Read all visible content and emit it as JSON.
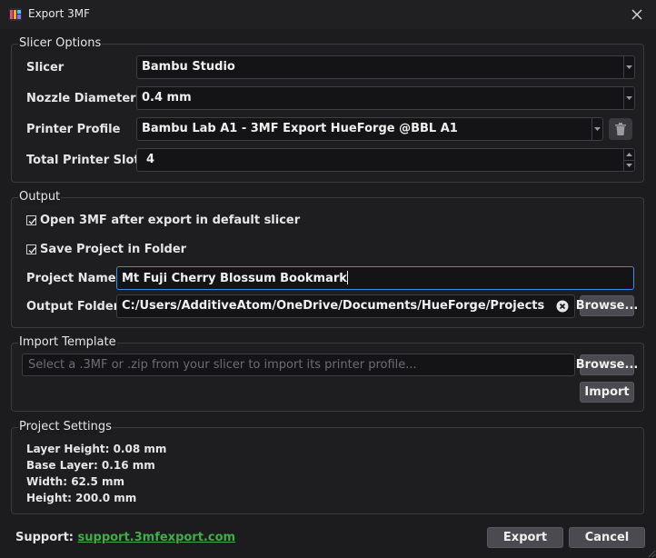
{
  "window": {
    "title": "Export 3MF"
  },
  "slicer_options": {
    "title": "Slicer Options",
    "slicer": {
      "label": "Slicer",
      "value": "Bambu Studio"
    },
    "nozzle": {
      "label": "Nozzle Diameter",
      "value": "0.4 mm"
    },
    "printer_profile": {
      "label": "Printer Profile",
      "value": "Bambu Lab A1 - 3MF Export HueForge @BBL A1"
    },
    "slots": {
      "label": "Total Printer Slots",
      "value": "4"
    }
  },
  "output": {
    "title": "Output",
    "open_after": {
      "label": "Open 3MF after export in default slicer",
      "checked": true
    },
    "save_project": {
      "label": "Save Project in Folder",
      "checked": true
    },
    "project_name": {
      "label": "Project Name",
      "value": "Mt Fuji Cherry Blossum Bookmark"
    },
    "output_folder": {
      "label": "Output Folder",
      "value": "C:/Users/AdditiveAtom/OneDrive/Documents/HueForge/Projects"
    },
    "browse_label": "Browse..."
  },
  "import_template": {
    "title": "Import Template",
    "placeholder": "Select a .3MF or .zip from your slicer to import its printer profile...",
    "browse_label": "Browse...",
    "import_label": "Import"
  },
  "project_settings": {
    "title": "Project Settings",
    "layer_height": "Layer Height: 0.08 mm",
    "base_layer": "Base Layer: 0.16 mm",
    "width": "Width: 62.5 mm",
    "height": "Height: 200.0 mm"
  },
  "footer": {
    "support_label": "Support:",
    "support_link": "support.3mfexport.com",
    "export_label": "Export",
    "cancel_label": "Cancel"
  },
  "colors": {
    "accent": "#3a8ee6",
    "link": "#3fae49",
    "background": "#1c1c1e"
  }
}
